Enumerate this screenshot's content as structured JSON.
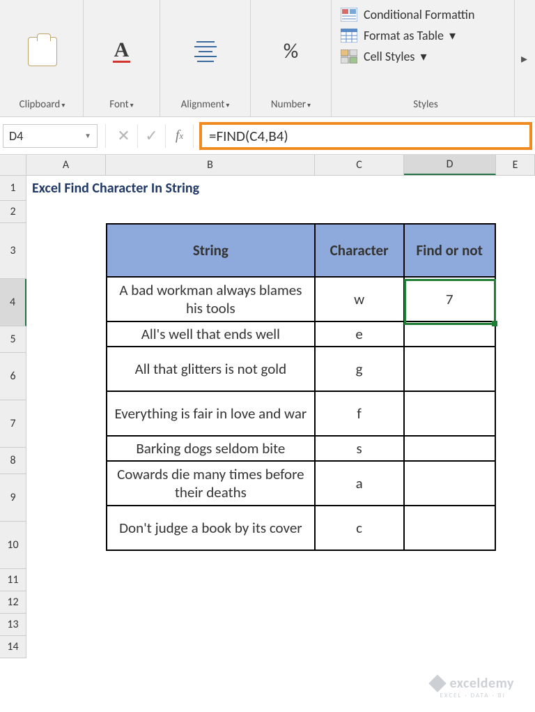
{
  "ribbon": {
    "clipboard": {
      "label": "Clipboard"
    },
    "font": {
      "label": "Font",
      "glyph": "A"
    },
    "alignment": {
      "label": "Alignment"
    },
    "number": {
      "label": "Number",
      "glyph": "%"
    },
    "styles": {
      "label": "Styles",
      "conditional": "Conditional Formattin",
      "table": "Format as Table",
      "cell": "Cell Styles"
    }
  },
  "fxbar": {
    "namebox": "D4",
    "formula": "=FIND(C4,B4)"
  },
  "columns": {
    "A": "A",
    "B": "B",
    "C": "C",
    "D": "D",
    "E": "E"
  },
  "rows": [
    "1",
    "2",
    "3",
    "4",
    "5",
    "6",
    "7",
    "8",
    "9",
    "10",
    "11",
    "12",
    "13",
    "14"
  ],
  "title": "Excel Find Character In String",
  "headers": {
    "string": "String",
    "char": "Character",
    "find": "Find or not"
  },
  "data": [
    {
      "s": "A bad workman always blames his tools",
      "c": "w",
      "f": "7"
    },
    {
      "s": "All's well that ends well",
      "c": "e",
      "f": ""
    },
    {
      "s": "All that glitters is not gold",
      "c": "g",
      "f": ""
    },
    {
      "s": "Everything is fair in love and war",
      "c": "f",
      "f": ""
    },
    {
      "s": "Barking dogs seldom bite",
      "c": "s",
      "f": ""
    },
    {
      "s": "Cowards die many times before their deaths",
      "c": "a",
      "f": ""
    },
    {
      "s": "Don't judge a book by its cover",
      "c": "c",
      "f": ""
    }
  ],
  "watermark": {
    "brand": "exceldemy",
    "sub": "EXCEL · DATA · BI"
  }
}
